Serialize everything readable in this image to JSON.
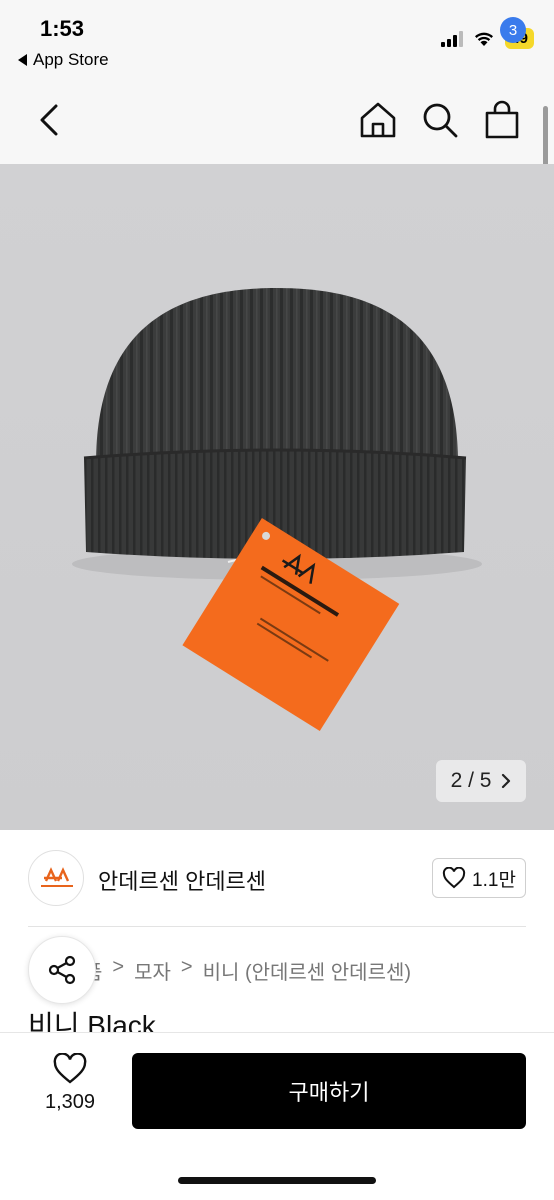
{
  "status_bar": {
    "time": "1:53",
    "back_app": "App Store",
    "battery": "49"
  },
  "nav": {
    "cart_count": "3"
  },
  "gallery": {
    "pager": "2 / 5"
  },
  "brand": {
    "name": "안데르센 안데르센",
    "likes": "1.1만",
    "logo_text": "ANDERSEN-ANDERSEN"
  },
  "breadcrumb": [
    "품",
    "모자",
    "비니 (안데르센 안데르센)"
  ],
  "product": {
    "title": "비니 Black"
  },
  "bottom": {
    "wish_count": "1,309",
    "buy_label": "구매하기"
  },
  "colors": {
    "accent_badge": "#3a7bec",
    "buy_button": "#000000",
    "tag_orange": "#f46b1d"
  }
}
